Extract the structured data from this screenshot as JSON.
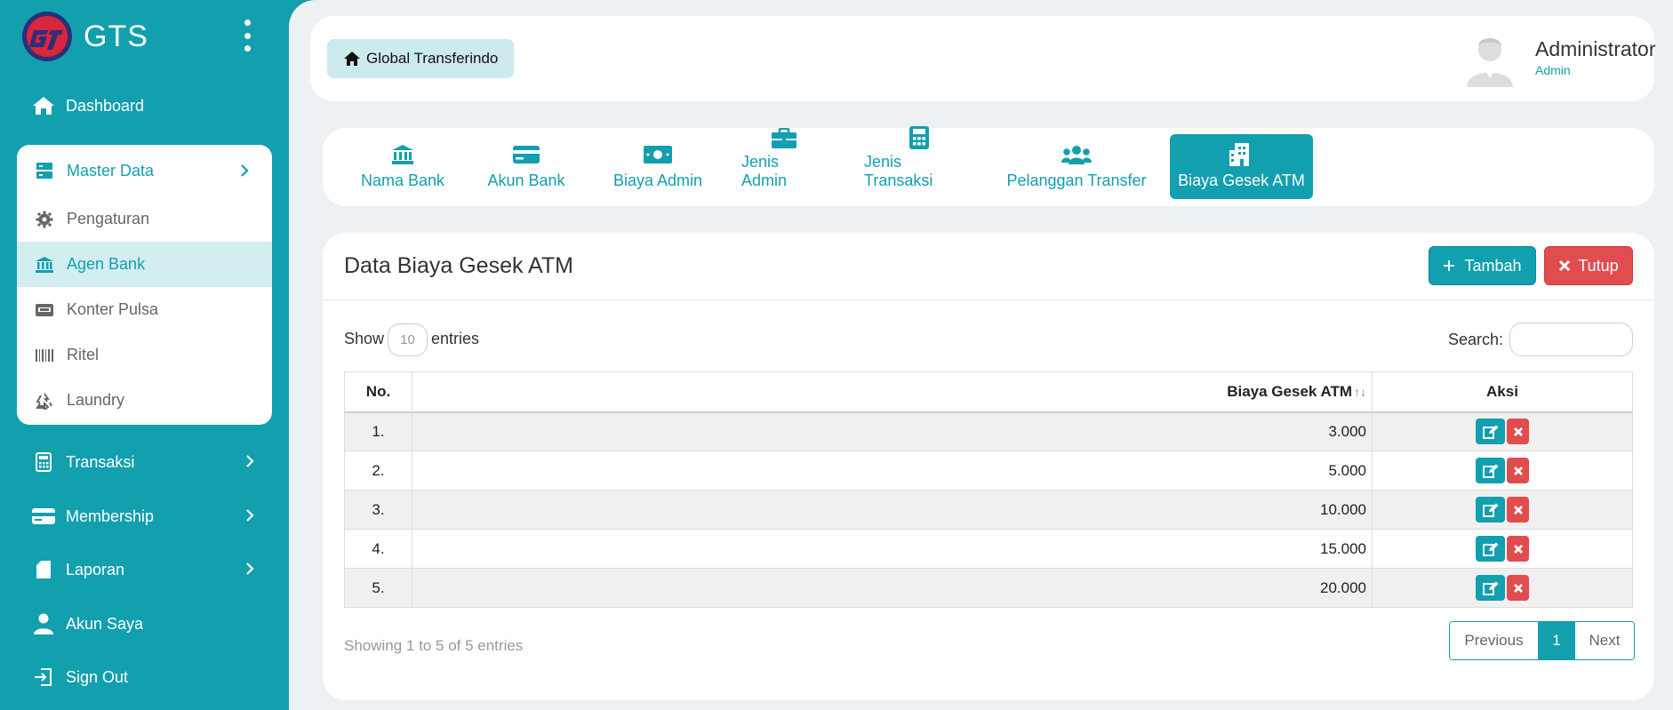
{
  "app": {
    "brand": "GTS"
  },
  "sidebar": {
    "dashboard": "Dashboard",
    "master_data": "Master Data",
    "master_items": [
      "Pengaturan",
      "Agen Bank",
      "Konter Pulsa",
      "Ritel",
      "Laundry"
    ],
    "active_item": "Agen Bank",
    "transaksi": "Transaksi",
    "membership": "Membership",
    "laporan": "Laporan",
    "akun_saya": "Akun Saya",
    "sign_out": "Sign Out"
  },
  "header": {
    "breadcrumb": "Global Transferindo",
    "user_name": "Administrator",
    "user_role": "Admin"
  },
  "tabs": [
    {
      "label": "Nama Bank",
      "icon": "bank-icon"
    },
    {
      "label": "Akun Bank",
      "icon": "credit-card-icon"
    },
    {
      "label": "Biaya Admin",
      "icon": "money-bill-icon"
    },
    {
      "label": "Jenis Admin",
      "icon": "briefcase-icon"
    },
    {
      "label": "Jenis Transaksi",
      "icon": "calculator-icon"
    },
    {
      "label": "Pelanggan Transfer",
      "icon": "users-icon"
    },
    {
      "label": "Biaya Gesek ATM",
      "icon": "building-icon",
      "active": true
    }
  ],
  "card": {
    "title": "Data Biaya Gesek ATM",
    "add_label": "Tambah",
    "close_label": "Tutup",
    "show_label": "Show",
    "page_length": "10",
    "entries_label": "entries",
    "search_label": "Search:",
    "search_value": ""
  },
  "table": {
    "headers": {
      "no": "No.",
      "value": "Biaya Gesek ATM",
      "actions": "Aksi"
    },
    "rows": [
      {
        "no": "1.",
        "value": "3.000"
      },
      {
        "no": "2.",
        "value": "5.000"
      },
      {
        "no": "3.",
        "value": "10.000"
      },
      {
        "no": "4.",
        "value": "15.000"
      },
      {
        "no": "5.",
        "value": "20.000"
      }
    ]
  },
  "footer": {
    "info": "Showing 1 to 5 of 5 entries",
    "previous": "Previous",
    "current_page": "1",
    "next": "Next"
  },
  "colors": {
    "accent": "#129fae",
    "danger": "#e14c4f",
    "active_bg": "#d3eef1"
  }
}
